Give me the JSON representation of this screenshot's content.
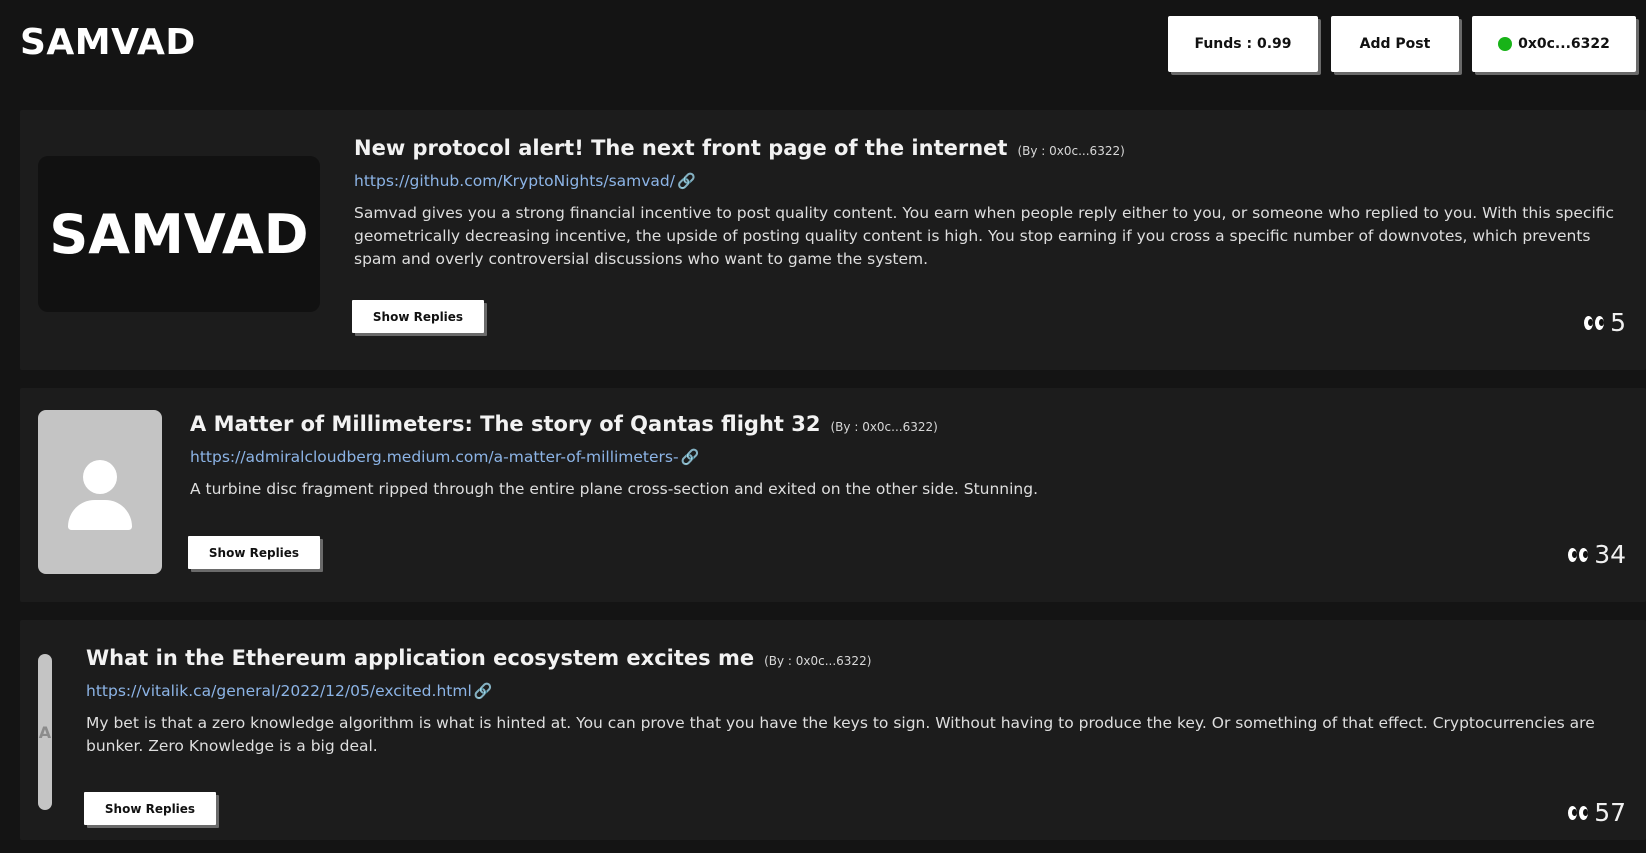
{
  "app": {
    "title": "SAMVAD"
  },
  "header": {
    "funds_label": "Funds : 0.99",
    "add_post_label": "Add Post",
    "wallet_label": "0x0c...6322",
    "wallet_status_color": "#18b318"
  },
  "posts": [
    {
      "thumbnail_text": "SAMVAD",
      "title": "New protocol alert! The next front page of the internet",
      "author": "(By : 0x0c...6322)",
      "link": "https://github.com/KryptoNights/samvad/",
      "body": "Samvad gives you a strong financial incentive to post quality content. You earn when people reply either to you, or someone who replied to you. With this specific geometrically decreasing incentive, the upside of posting quality content is high. You stop earning if you cross a specific number of downvotes, which prevents spam and overly controversial discussions who want to game the system.",
      "reply_label": "Show Replies",
      "views": "5"
    },
    {
      "thumbnail_icon": "user-avatar-icon",
      "title": "A Matter of Millimeters: The story of Qantas flight 32",
      "author": "(By : 0x0c...6322)",
      "link": "https://admiralcloudberg.medium.com/a-matter-of-millimeters-",
      "body": "A turbine disc fragment ripped through the entire plane cross-section and exited on the other side. Stunning.",
      "reply_label": "Show Replies",
      "views": "34"
    },
    {
      "thumbnail_text": "A",
      "title": "What in the Ethereum application ecosystem excites me",
      "author": "(By : 0x0c...6322)",
      "link": "https://vitalik.ca/general/2022/12/05/excited.html",
      "body": "My bet is that a zero knowledge algorithm is what is hinted at. You can prove that you have the keys to sign. Without having to produce the key. Or something of that effect. Cryptocurrencies are bunker. Zero Knowledge is a big deal.",
      "reply_label": "Show Replies",
      "views": "57"
    }
  ],
  "icons": {
    "link": "🔗",
    "views": "eyes-icon"
  }
}
